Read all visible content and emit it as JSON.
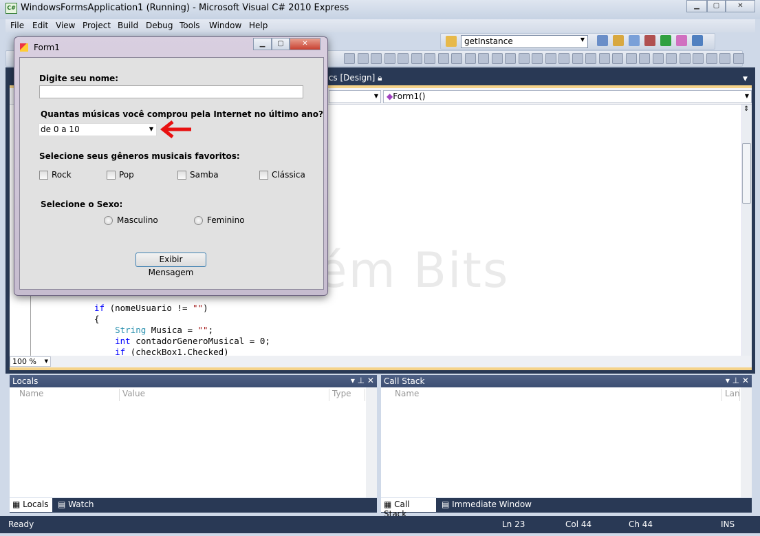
{
  "window": {
    "title": "WindowsFormsApplication1 (Running) - Microsoft Visual C# 2010 Express",
    "icon": "csharp-icon",
    "controls": [
      "minimize",
      "maximize",
      "close"
    ]
  },
  "menu": [
    "File",
    "Edit",
    "View",
    "Project",
    "Build",
    "Debug",
    "Tools",
    "Window",
    "Help"
  ],
  "toolbar": {
    "find_value": "getInstance"
  },
  "document": {
    "tab_label": ".cs [Design]",
    "member_dropdown": "Form1()",
    "zoom": "100 %"
  },
  "code": {
    "lines": [
      [
        {
          "t": "if",
          "c": "kw"
        },
        {
          "t": " (nomeUsuario != ",
          "c": ""
        },
        {
          "t": "\"\"",
          "c": "st"
        },
        {
          "t": ")",
          "c": ""
        }
      ],
      [
        {
          "t": "{",
          "c": ""
        }
      ],
      [
        {
          "t": "    ",
          "c": ""
        },
        {
          "t": "String",
          "c": "ty"
        },
        {
          "t": " Musica = ",
          "c": ""
        },
        {
          "t": "\"\"",
          "c": "st"
        },
        {
          "t": ";",
          "c": ""
        }
      ],
      [
        {
          "t": "    ",
          "c": ""
        },
        {
          "t": "int",
          "c": "kw"
        },
        {
          "t": " contadorGeneroMusical = 0;",
          "c": ""
        }
      ],
      [
        {
          "t": "    ",
          "c": ""
        },
        {
          "t": "if",
          "c": "kw"
        },
        {
          "t": " (checkBox1.Checked)",
          "c": ""
        }
      ]
    ]
  },
  "watermark": "Contém Bits",
  "form": {
    "title": "Form1",
    "name_label": "Digite seu nome:",
    "name_value": "",
    "music_label": "Quantas músicas você comprou pela Internet no último ano?",
    "music_value": "de 0 a 10",
    "genres_label": "Selecione seus gêneros musicais favoritos:",
    "genres": [
      {
        "label": "Rock",
        "checked": false
      },
      {
        "label": "Pop",
        "checked": false
      },
      {
        "label": "Samba",
        "checked": false
      },
      {
        "label": "Clássica",
        "checked": false
      }
    ],
    "sex_label": "Selecione o Sexo:",
    "sex": [
      {
        "label": "Masculino",
        "selected": false
      },
      {
        "label": "Feminino",
        "selected": false
      }
    ],
    "button": "Exibir Mensagem",
    "arrow_color": "#e81010"
  },
  "locals": {
    "title": "Locals",
    "columns": [
      "Name",
      "Value",
      "Type"
    ],
    "tabs": [
      "Locals",
      "Watch"
    ]
  },
  "callstack": {
    "title": "Call Stack",
    "columns": [
      "Name",
      "Lang"
    ],
    "tabs": [
      "Call Stack",
      "Immediate Window"
    ]
  },
  "status": {
    "text": "Ready",
    "ln": "Ln 23",
    "col": "Col 44",
    "ch": "Ch 44",
    "mode": "INS"
  }
}
